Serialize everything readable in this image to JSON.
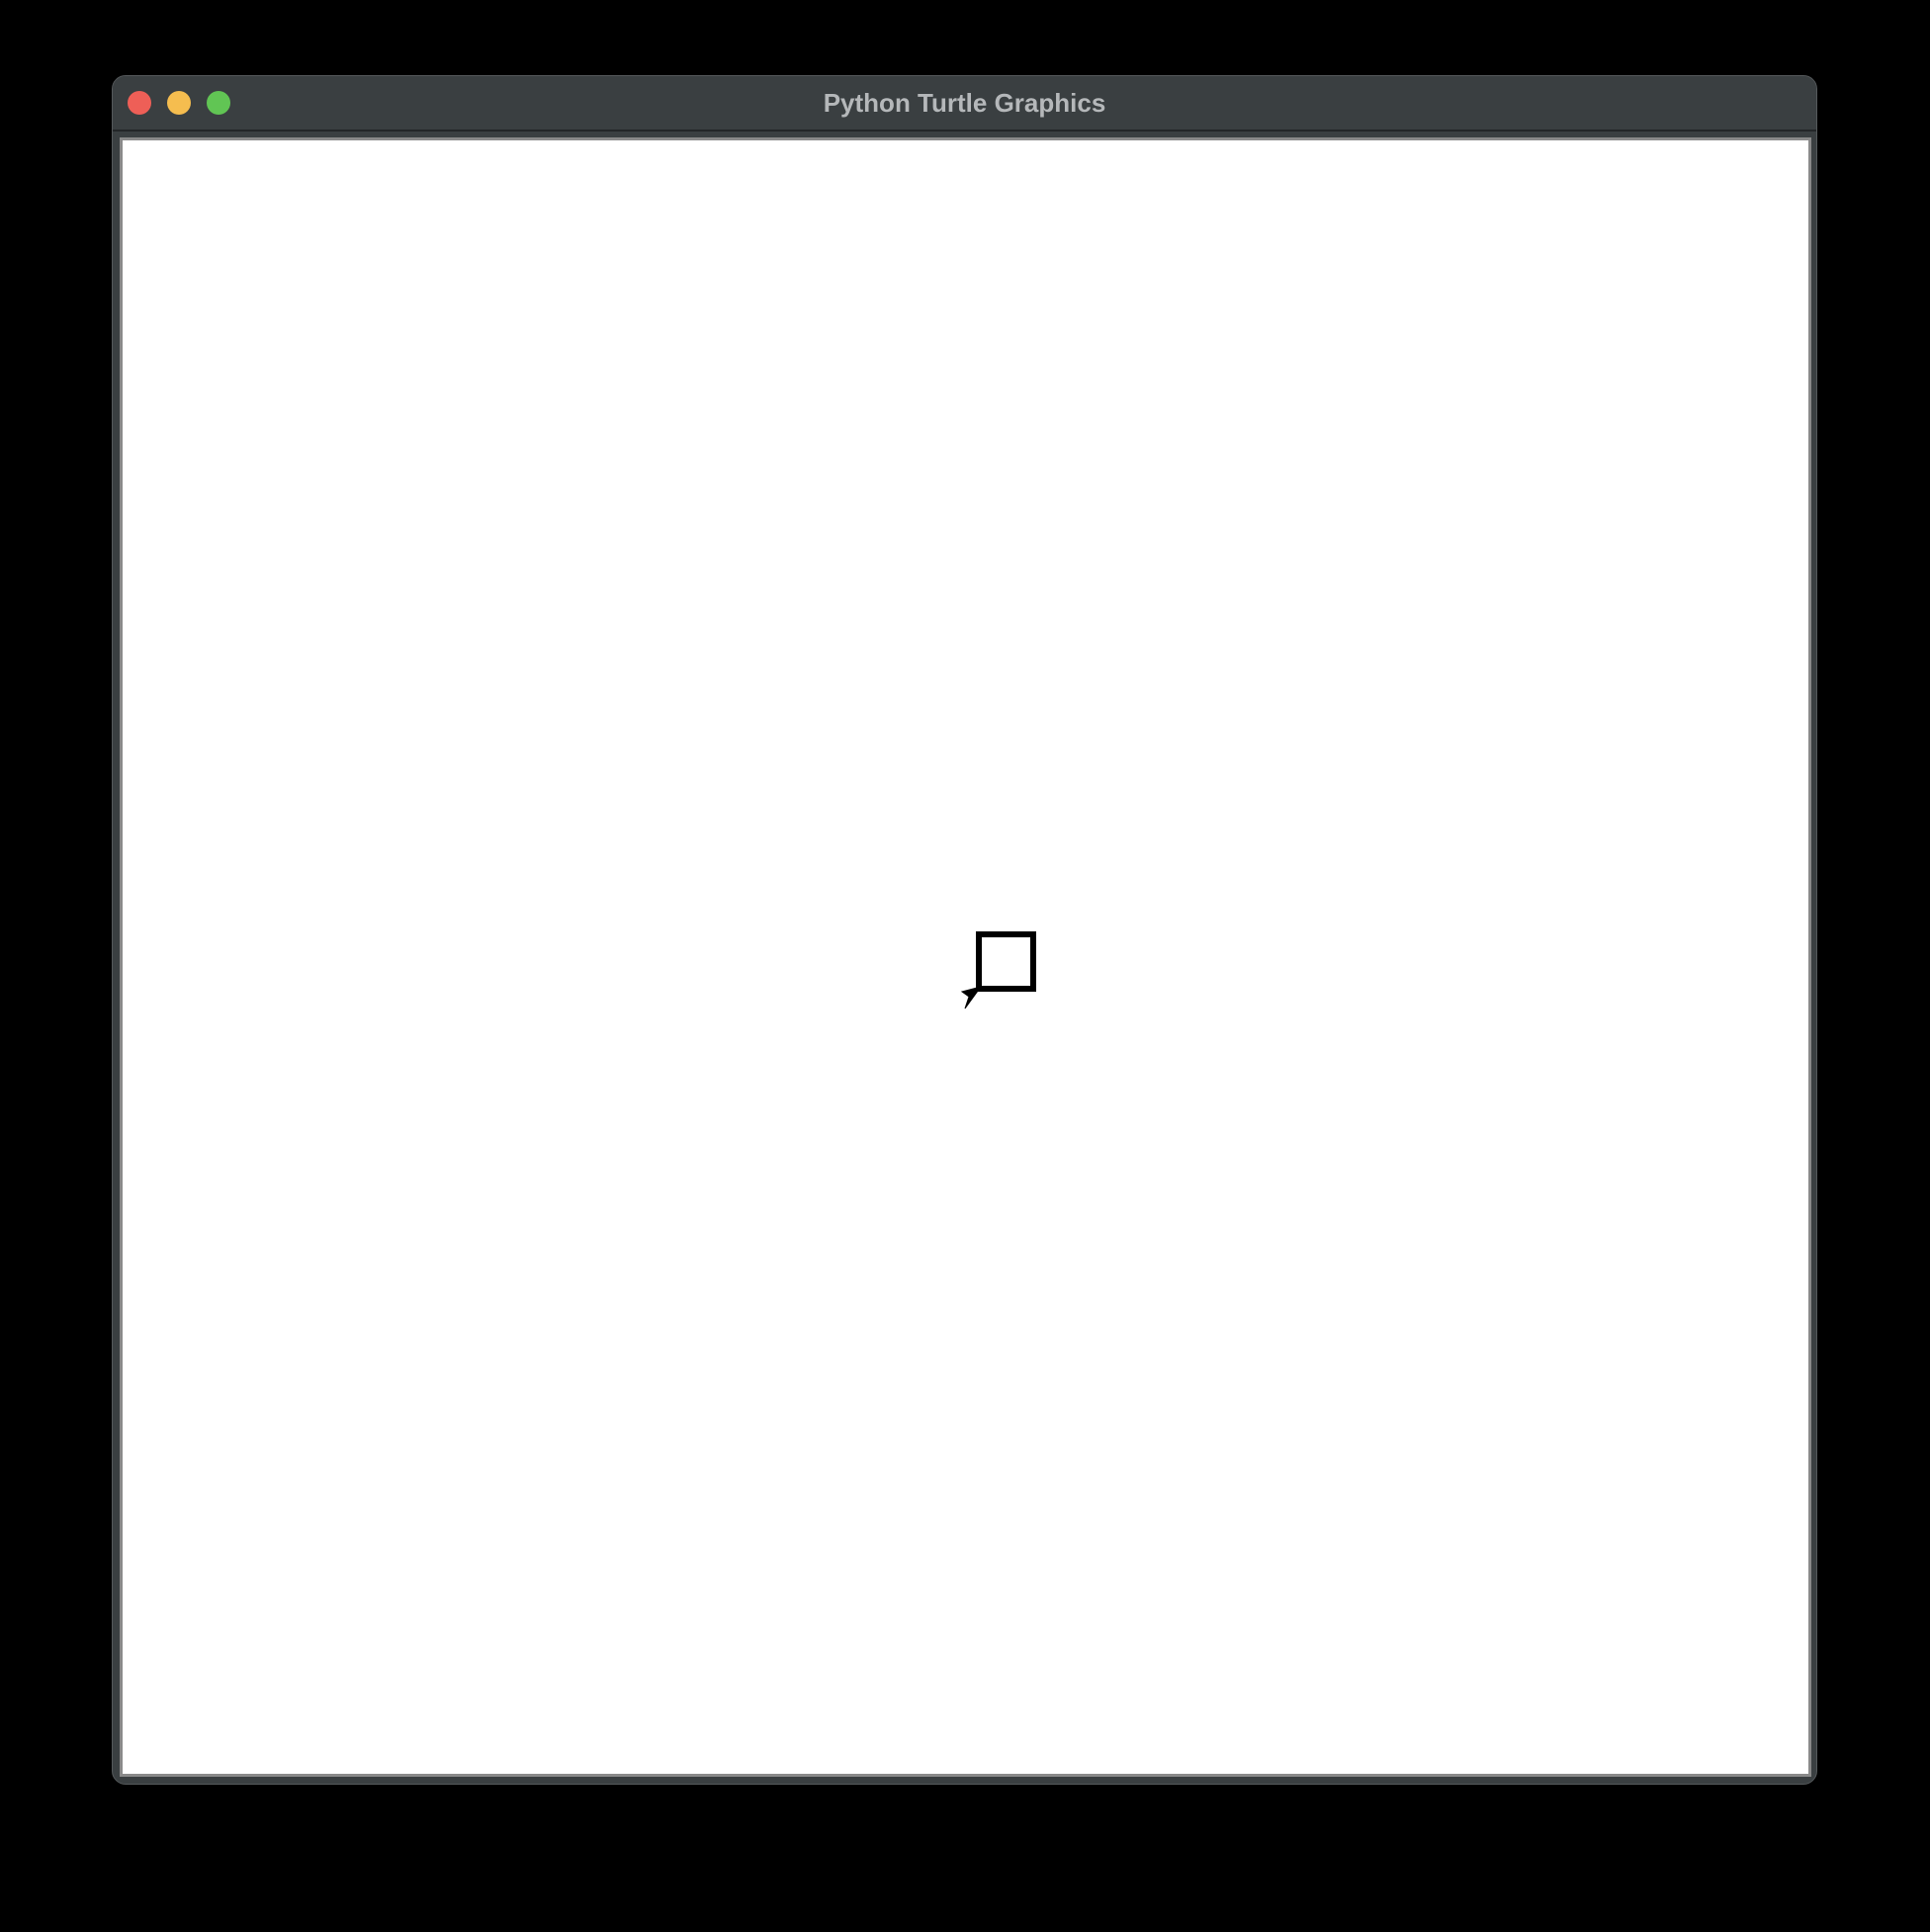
{
  "window": {
    "title": "Python Turtle Graphics"
  },
  "traffic_lights": {
    "close_color": "#ee5f57",
    "minimize_color": "#f5bd4f",
    "zoom_color": "#61c554"
  },
  "canvas": {
    "background": "#ffffff",
    "pen_color": "#000000",
    "drawn_shape": "square",
    "turtle_shape": "classic-arrow-icon"
  }
}
